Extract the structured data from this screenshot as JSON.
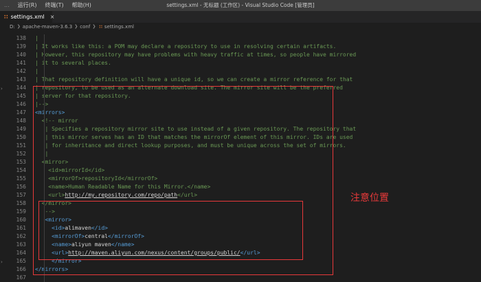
{
  "window": {
    "title": "settings.xml - 无标题 (工作区) - Visual Studio Code [管理员]",
    "menu": [
      "...",
      "运行(R)",
      "终端(T)",
      "帮助(H)"
    ]
  },
  "tab": {
    "name": "settings.xml",
    "icon": "rss-icon",
    "close": "×"
  },
  "breadcrumb": [
    "D:",
    "apache-maven-3.6.3",
    "conf",
    "settings.xml"
  ],
  "lines": [
    {
      "n": "138",
      "segs": [
        {
          "c": "c",
          "t": "| "
        }
      ]
    },
    {
      "n": "139",
      "segs": [
        {
          "c": "c",
          "t": "| It works like this: a POM may declare a repository to use in resolving certain artifacts."
        }
      ]
    },
    {
      "n": "140",
      "segs": [
        {
          "c": "c",
          "t": "| However, this repository may have problems with heavy traffic at times, so people have mirrored"
        }
      ]
    },
    {
      "n": "141",
      "segs": [
        {
          "c": "c",
          "t": "| it to several places."
        }
      ]
    },
    {
      "n": "142",
      "segs": [
        {
          "c": "c",
          "t": "|"
        }
      ]
    },
    {
      "n": "143",
      "segs": [
        {
          "c": "c",
          "t": "| That repository definition will have a unique id, so we can create a mirror reference for that"
        }
      ]
    },
    {
      "n": "144",
      "segs": [
        {
          "c": "c",
          "t": "| repository, to be used as an alternate download site. The mirror site will be the preferred"
        }
      ]
    },
    {
      "n": "145",
      "segs": [
        {
          "c": "c",
          "t": "| server for that repository."
        }
      ]
    },
    {
      "n": "146",
      "segs": [
        {
          "c": "c",
          "t": "|-->"
        }
      ]
    },
    {
      "n": "147",
      "segs": [
        {
          "c": "t",
          "t": "<mirrors>"
        }
      ]
    },
    {
      "n": "148",
      "segs": [
        {
          "c": "c",
          "t": "  <!-- mirror"
        }
      ]
    },
    {
      "n": "149",
      "segs": [
        {
          "c": "c",
          "t": "   | Specifies a repository mirror site to use instead of a given repository. The repository that"
        }
      ]
    },
    {
      "n": "150",
      "segs": [
        {
          "c": "c",
          "t": "   | this mirror serves has an ID that matches the mirrorOf element of this mirror. IDs are used"
        }
      ]
    },
    {
      "n": "151",
      "segs": [
        {
          "c": "c",
          "t": "   | for inheritance and direct lookup purposes, and must be unique across the set of mirrors."
        }
      ]
    },
    {
      "n": "152",
      "segs": [
        {
          "c": "c",
          "t": "   |"
        }
      ]
    },
    {
      "n": "153",
      "segs": [
        {
          "c": "c",
          "t": "  <mirror>"
        }
      ]
    },
    {
      "n": "154",
      "segs": [
        {
          "c": "c",
          "t": "    <id>mirrorId</id>"
        }
      ]
    },
    {
      "n": "155",
      "segs": [
        {
          "c": "c",
          "t": "    <mirrorOf>repositoryId</mirrorOf>"
        }
      ]
    },
    {
      "n": "156",
      "segs": [
        {
          "c": "c",
          "t": "    <name>Human Readable Name for this Mirror.</name>"
        }
      ]
    },
    {
      "n": "157",
      "segs": [
        {
          "c": "c",
          "t": "    <url>"
        },
        {
          "c": "u",
          "t": "http://my.repository.com/repo/path"
        },
        {
          "c": "c",
          "t": "</url>"
        }
      ]
    },
    {
      "n": "158",
      "segs": [
        {
          "c": "c",
          "t": "  </mirror>"
        }
      ]
    },
    {
      "n": "159",
      "segs": [
        {
          "c": "c",
          "t": "   -->"
        }
      ]
    },
    {
      "n": "160",
      "segs": [
        {
          "c": "t",
          "t": "   <mirror>"
        }
      ]
    },
    {
      "n": "161",
      "segs": [
        {
          "c": "t",
          "t": "     <id>"
        },
        {
          "c": "x",
          "t": "alimaven"
        },
        {
          "c": "t",
          "t": "</id>"
        }
      ]
    },
    {
      "n": "162",
      "segs": [
        {
          "c": "t",
          "t": "     <mirrorOf>"
        },
        {
          "c": "x",
          "t": "central"
        },
        {
          "c": "t",
          "t": "</mirrorOf>"
        }
      ]
    },
    {
      "n": "163",
      "segs": [
        {
          "c": "t",
          "t": "     <name>"
        },
        {
          "c": "x",
          "t": "aliyun maven"
        },
        {
          "c": "t",
          "t": "</name>"
        }
      ]
    },
    {
      "n": "164",
      "segs": [
        {
          "c": "t",
          "t": "     <url>"
        },
        {
          "c": "u",
          "t": "http://maven.aliyun.com/nexus/content/groups/public/"
        },
        {
          "c": "t",
          "t": "</url>"
        }
      ]
    },
    {
      "n": "165",
      "segs": [
        {
          "c": "t",
          "t": "     </mirror>"
        }
      ]
    },
    {
      "n": "166",
      "segs": [
        {
          "c": "t",
          "t": "</mirrors>"
        }
      ]
    },
    {
      "n": "167",
      "segs": [
        {
          "c": "x",
          "t": ""
        }
      ]
    }
  ],
  "annotation": {
    "label": "注意位置",
    "color": "#e8393a"
  },
  "colors": {
    "comment": "#6a9955",
    "tag": "#569cd6",
    "text": "#d4d4d4",
    "line_number": "#858585"
  }
}
